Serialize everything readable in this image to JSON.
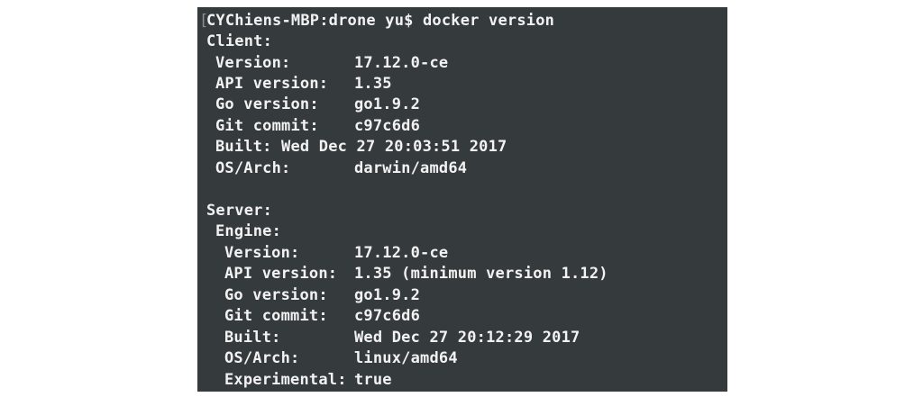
{
  "terminal": {
    "prompt": "CYChiens-MBP:drone yu$ docker version",
    "client": {
      "header": "Client:",
      "version_label": "Version:",
      "version_value": "17.12.0-ce",
      "api_label": "API version:",
      "api_value": "1.35",
      "go_label": "Go version:",
      "go_value": "go1.9.2",
      "git_label": "Git commit:",
      "git_value": "c97c6d6",
      "built_line": "Built: Wed Dec 27 20:03:51 2017",
      "os_label": "OS/Arch:",
      "os_value": "darwin/amd64"
    },
    "server": {
      "header": "Server:",
      "engine_header": "Engine:",
      "version_label": "Version:",
      "version_value": "17.12.0-ce",
      "api_label": "API version:",
      "api_value": "1.35 (minimum version 1.12)",
      "go_label": "Go version:",
      "go_value": "go1.9.2",
      "git_label": "Git commit:",
      "git_value": "c97c6d6",
      "built_label": "Built:",
      "built_value": "Wed Dec 27 20:12:29 2017",
      "os_label": "OS/Arch:",
      "os_value": "linux/amd64",
      "experimental_label": "Experimental:",
      "experimental_value": "true"
    }
  }
}
